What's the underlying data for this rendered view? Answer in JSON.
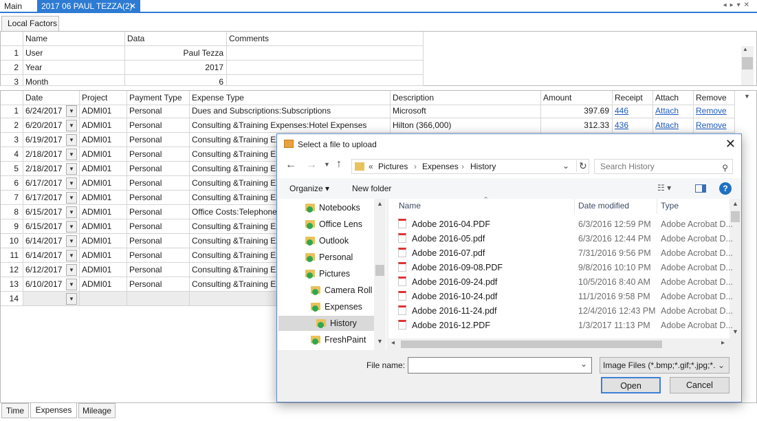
{
  "tabs": {
    "main": "Main",
    "document": "2017 06 PAUL TEZZA(2)",
    "close": "✕"
  },
  "local_factors": {
    "tab_label": "Local Factors",
    "headers": [
      "Name",
      "Data",
      "Comments"
    ],
    "rows": [
      {
        "n": "1",
        "name": "User",
        "data": "Paul Tezza"
      },
      {
        "n": "2",
        "name": "Year",
        "data": "2017"
      },
      {
        "n": "3",
        "name": "Month",
        "data": "6"
      }
    ]
  },
  "expenses": {
    "headers": [
      "Date",
      "Project",
      "Payment Type",
      "Expense Type",
      "Description",
      "Amount",
      "Receipt",
      "Attach",
      "Remove"
    ],
    "rows": [
      {
        "n": "1",
        "date": "6/24/2017",
        "project": "ADMI01",
        "pay": "Personal",
        "type": "Dues and Subscriptions:Subscriptions",
        "desc": "Microsoft",
        "amount": "397.69",
        "receipt": "446",
        "attach": "Attach",
        "remove": "Remove"
      },
      {
        "n": "2",
        "date": "6/20/2017",
        "project": "ADMI01",
        "pay": "Personal",
        "type": "Consulting &Training Expenses:Hotel Expenses",
        "desc": "Hilton (366,000)",
        "amount": "312.33",
        "receipt": "436",
        "attach": "Attach",
        "remove": "Remove"
      },
      {
        "n": "3",
        "date": "6/19/2017",
        "project": "ADMI01",
        "pay": "Personal",
        "type": "Consulting &Training Expe"
      },
      {
        "n": "4",
        "date": "2/18/2017",
        "project": "ADMI01",
        "pay": "Personal",
        "type": "Consulting &Training Expe"
      },
      {
        "n": "5",
        "date": "2/18/2017",
        "project": "ADMI01",
        "pay": "Personal",
        "type": "Consulting &Training Expe"
      },
      {
        "n": "6",
        "date": "6/17/2017",
        "project": "ADMI01",
        "pay": "Personal",
        "type": "Consulting &Training Expe"
      },
      {
        "n": "7",
        "date": "6/17/2017",
        "project": "ADMI01",
        "pay": "Personal",
        "type": "Consulting &Training Expe"
      },
      {
        "n": "8",
        "date": "6/15/2017",
        "project": "ADMI01",
        "pay": "Personal",
        "type": "Office Costs:Telephone:C"
      },
      {
        "n": "9",
        "date": "6/15/2017",
        "project": "ADMI01",
        "pay": "Personal",
        "type": "Consulting &Training Expe"
      },
      {
        "n": "10",
        "date": "6/14/2017",
        "project": "ADMI01",
        "pay": "Personal",
        "type": "Consulting &Training Expe"
      },
      {
        "n": "11",
        "date": "6/14/2017",
        "project": "ADMI01",
        "pay": "Personal",
        "type": "Consulting &Training Expe"
      },
      {
        "n": "12",
        "date": "6/12/2017",
        "project": "ADMI01",
        "pay": "Personal",
        "type": "Consulting &Training Expe"
      },
      {
        "n": "13",
        "date": "6/10/2017",
        "project": "ADMI01",
        "pay": "Personal",
        "type": "Consulting &Training Expe"
      },
      {
        "n": "14",
        "date": "",
        "project": "",
        "pay": "",
        "type": ""
      }
    ]
  },
  "bottom_tabs": [
    "Time",
    "Expenses",
    "Mileage"
  ],
  "dialog": {
    "title": "Select a file to upload",
    "breadcrumb": [
      "«",
      "Pictures",
      "Expenses",
      "History"
    ],
    "search_placeholder": "Search History",
    "organize": "Organize ▾",
    "new_folder": "New folder",
    "tree": [
      "Notebooks",
      "Office Lens",
      "Outlook",
      "Personal",
      "Pictures",
      "Camera Roll",
      "Expenses",
      "History",
      "FreshPaint"
    ],
    "columns": [
      "Name",
      "Date modified",
      "Type"
    ],
    "files": [
      {
        "name": "Adobe 2016-04.PDF",
        "date": "6/3/2016 12:59 PM",
        "type": "Adobe Acrobat D..."
      },
      {
        "name": "Adobe 2016-05.pdf",
        "date": "6/3/2016 12:44 PM",
        "type": "Adobe Acrobat D..."
      },
      {
        "name": "Adobe 2016-07.pdf",
        "date": "7/31/2016 9:56 PM",
        "type": "Adobe Acrobat D..."
      },
      {
        "name": "Adobe 2016-09-08.PDF",
        "date": "9/8/2016 10:10 PM",
        "type": "Adobe Acrobat D..."
      },
      {
        "name": "Adobe 2016-09-24.pdf",
        "date": "10/5/2016 8:40 AM",
        "type": "Adobe Acrobat D..."
      },
      {
        "name": "Adobe 2016-10-24.pdf",
        "date": "11/1/2016 9:58 PM",
        "type": "Adobe Acrobat D..."
      },
      {
        "name": "Adobe 2016-11-24.pdf",
        "date": "12/4/2016 12:43 PM",
        "type": "Adobe Acrobat D..."
      },
      {
        "name": "Adobe 2016-12.PDF",
        "date": "1/3/2017 11:13 PM",
        "type": "Adobe Acrobat D..."
      }
    ],
    "file_name_label": "File name:",
    "file_name_value": "",
    "filter": "Image Files (*.bmp;*.gif;*.jpg;*.",
    "open": "Open",
    "cancel": "Cancel"
  }
}
